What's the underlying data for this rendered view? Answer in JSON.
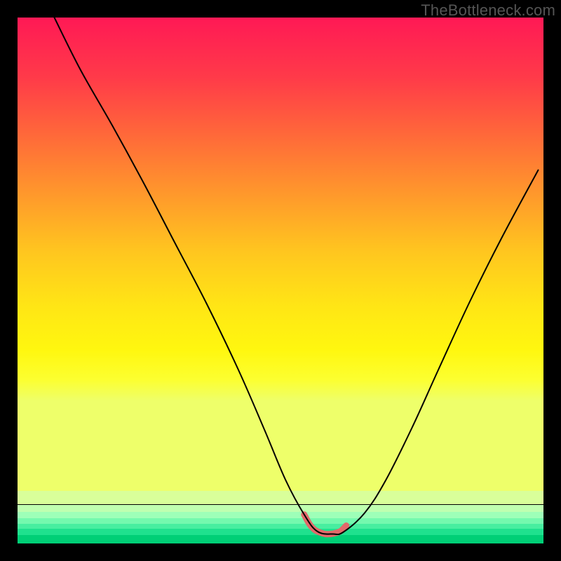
{
  "watermark": {
    "text": "TheBottleneck.com"
  },
  "gradient": {
    "main_stops": [
      {
        "offset": 0.0,
        "color": "#ff1955"
      },
      {
        "offset": 0.14,
        "color": "#ff3a49"
      },
      {
        "offset": 0.28,
        "color": "#ff6a39"
      },
      {
        "offset": 0.42,
        "color": "#ff9a2b"
      },
      {
        "offset": 0.55,
        "color": "#ffc61f"
      },
      {
        "offset": 0.68,
        "color": "#ffe615"
      },
      {
        "offset": 0.78,
        "color": "#fff70f"
      },
      {
        "offset": 0.85,
        "color": "#fcff30"
      },
      {
        "offset": 0.9,
        "color": "#eeff6a"
      }
    ],
    "bottom_bands": [
      {
        "top_pct": 90.0,
        "height_pct": 2.6,
        "color": "#d9ff9a"
      },
      {
        "top_pct": 92.6,
        "height_pct": 1.4,
        "color": "#bfffb0"
      },
      {
        "top_pct": 94.0,
        "height_pct": 1.2,
        "color": "#9effb8"
      },
      {
        "top_pct": 95.2,
        "height_pct": 1.0,
        "color": "#74f9ae"
      },
      {
        "top_pct": 96.2,
        "height_pct": 1.0,
        "color": "#48eea0"
      },
      {
        "top_pct": 97.2,
        "height_pct": 1.2,
        "color": "#1fe18e"
      },
      {
        "top_pct": 98.4,
        "height_pct": 1.6,
        "color": "#00cf76"
      }
    ]
  },
  "chart_data": {
    "type": "line",
    "title": "",
    "xlabel": "",
    "ylabel": "",
    "xlim": [
      0,
      100
    ],
    "ylim": [
      0,
      100
    ],
    "series": [
      {
        "name": "bottleneck-curve",
        "x": [
          7,
          12,
          18,
          24,
          30,
          36,
          42,
          47,
          51,
          54.5,
          57,
          60,
          62,
          66,
          70,
          75,
          80,
          86,
          92,
          99
        ],
        "values": [
          100,
          90,
          79.5,
          68.5,
          57,
          45.5,
          33,
          21.5,
          12,
          5.5,
          2.3,
          1.8,
          2.2,
          5.8,
          12,
          22,
          33,
          46,
          58,
          71
        ],
        "stroke": "#000000",
        "stroke_width": 2
      },
      {
        "name": "minimum-highlight",
        "x": [
          54.5,
          55.5,
          56.5,
          57.5,
          58.5,
          59.5,
          60.5,
          61.5,
          62.5
        ],
        "values": [
          5.5,
          3.7,
          2.6,
          2.1,
          1.8,
          1.8,
          2.0,
          2.4,
          3.4
        ],
        "stroke": "#e26a6a",
        "stroke_width": 9
      }
    ]
  }
}
